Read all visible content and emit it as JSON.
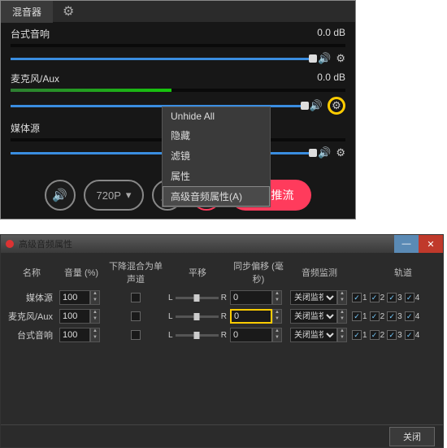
{
  "mixer": {
    "tab": "混音器",
    "sources": [
      {
        "name": "台式音响",
        "db": "0.0 dB",
        "meter": 0,
        "slider": 100,
        "gear_hl": false
      },
      {
        "name": "麦克风/Aux",
        "db": "0.0 dB",
        "meter": 48,
        "slider": 100,
        "gear_hl": true
      },
      {
        "name": "媒体源",
        "db": "",
        "meter": 0,
        "slider": 100,
        "gear_hl": false
      }
    ]
  },
  "context_menu": {
    "items": [
      "Unhide All",
      "隐藏",
      "滤镜",
      "属性"
    ],
    "highlight": "高级音频属性(A)"
  },
  "toolbar": {
    "quality": "720P",
    "start": "开始推流"
  },
  "dialog": {
    "title": "高级音频属性",
    "headers": [
      "名称",
      "音量 (%)",
      "下降混合为单声道",
      "平移",
      "同步偏移 (毫秒)",
      "音频监测",
      "轨道"
    ],
    "rows": [
      {
        "name": "媒体源",
        "vol": "100",
        "mono": false,
        "offset": "0",
        "offset_hl": false,
        "monitor": "关闭监视",
        "tracks": [
          true,
          true,
          true,
          true
        ]
      },
      {
        "name": "麦克风/Aux",
        "vol": "100",
        "mono": false,
        "offset": "0",
        "offset_hl": true,
        "monitor": "关闭监视",
        "tracks": [
          true,
          true,
          true,
          true
        ]
      },
      {
        "name": "台式音响",
        "vol": "100",
        "mono": false,
        "offset": "0",
        "offset_hl": false,
        "monitor": "关闭监视",
        "tracks": [
          true,
          true,
          true,
          true
        ]
      }
    ],
    "bal_left": "L",
    "bal_right": "R",
    "close": "关闭"
  }
}
